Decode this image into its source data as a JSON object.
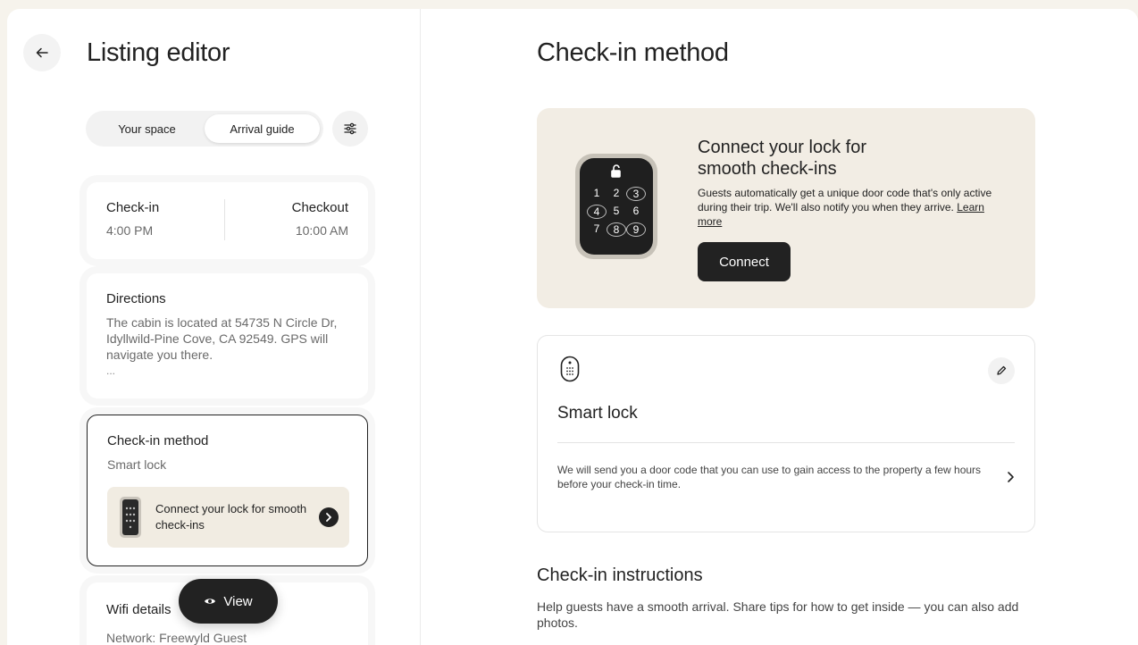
{
  "left": {
    "title": "Listing editor",
    "tabs": [
      {
        "label": "Your space",
        "active": false
      },
      {
        "label": "Arrival guide",
        "active": true
      }
    ],
    "checkin_card": {
      "checkin_label": "Check-in",
      "checkin_time": "4:00 PM",
      "checkout_label": "Checkout",
      "checkout_time": "10:00 AM"
    },
    "directions_card": {
      "title": "Directions",
      "text": "The cabin is located at 54735 N Circle Dr, Idyllwild-Pine Cove, CA 92549. GPS will navigate you there.",
      "ellipsis": "..."
    },
    "method_card": {
      "title": "Check-in method",
      "value": "Smart lock",
      "promo_text": "Connect your lock for smooth check-ins"
    },
    "wifi_card": {
      "title": "Wifi details",
      "network": "Network: Freewyld Guest"
    },
    "view_button": "View"
  },
  "right": {
    "title": "Check-in method",
    "promo": {
      "heading": "Connect your lock for smooth check-ins",
      "body": "Guests automatically get a unique door code that's only active during their trip. We'll also notify you when they arrive.",
      "learn_more": "Learn more",
      "connect_button": "Connect",
      "keypad_keys": [
        "1",
        "2",
        "3",
        "4",
        "5",
        "6",
        "7",
        "8",
        "9"
      ]
    },
    "smart_lock_card": {
      "title": "Smart lock",
      "description": "We will send you a door code that you can use to gain access to the property a few hours before your check-in time."
    },
    "instructions": {
      "title": "Check-in instructions",
      "body": "Help guests have a smooth arrival. Share tips for how to get inside — you can also add photos."
    }
  },
  "colors": {
    "background": "#f6f3ec",
    "promo_bg": "#f2ede4",
    "primary_dark": "#222222",
    "muted_text": "#6a6a6a"
  },
  "icons": [
    "back-arrow-icon",
    "filter-sliders-icon",
    "keypad-lock-icon",
    "smart-lock-icon",
    "pencil-icon",
    "chevron-right-icon",
    "eye-icon"
  ]
}
